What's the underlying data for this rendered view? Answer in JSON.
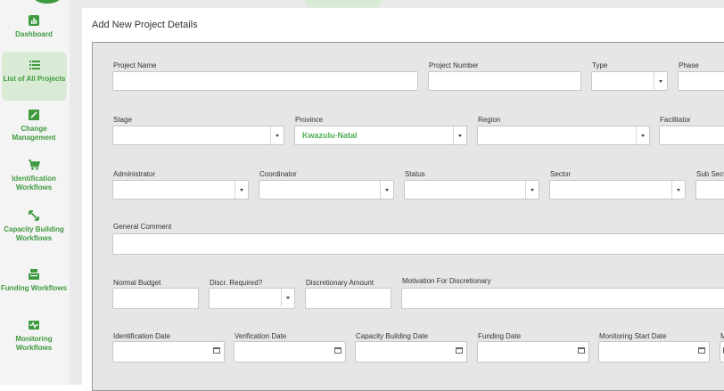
{
  "sidebar": {
    "items": [
      {
        "label": "Dashboard",
        "icon": "bar-chart-icon"
      },
      {
        "label": "List of All Projects",
        "icon": "list-icon",
        "active": true
      },
      {
        "label": "Change Management",
        "icon": "edit-icon"
      },
      {
        "label": "Identification Workflows",
        "icon": "cart-icon"
      },
      {
        "label": "Capacity Building Workflows",
        "icon": "arrows-icon"
      },
      {
        "label": "Funding Workflows",
        "icon": "register-icon"
      },
      {
        "label": "Monitoring Workflows",
        "icon": "pulse-icon"
      }
    ]
  },
  "modal": {
    "title": "Add New Project Details",
    "fields": {
      "project_name": {
        "label": "Project Name",
        "value": ""
      },
      "project_number": {
        "label": "Project Number",
        "value": ""
      },
      "type": {
        "label": "Type",
        "value": ""
      },
      "phase": {
        "label": "Phase",
        "value": ""
      },
      "stage": {
        "label": "Stage",
        "value": ""
      },
      "province": {
        "label": "Province",
        "value": "Kwazulu-Natal"
      },
      "region": {
        "label": "Region",
        "value": ""
      },
      "facilitator": {
        "label": "Facilitator",
        "value": ""
      },
      "administrator": {
        "label": "Administrator",
        "value": ""
      },
      "coordinator": {
        "label": "Coordinator",
        "value": ""
      },
      "status": {
        "label": "Status",
        "value": ""
      },
      "sector": {
        "label": "Sector",
        "value": ""
      },
      "sub_sector": {
        "label": "Sub Sect",
        "value": ""
      },
      "general_comment": {
        "label": "General Comment",
        "value": ""
      },
      "normal_budget": {
        "label": "Normal Budget",
        "value": ""
      },
      "discr_required": {
        "label": "Discr. Required?",
        "value": ""
      },
      "discretionary_amount": {
        "label": "Discretionary Amount",
        "value": ""
      },
      "motivation": {
        "label": "Motivation For Discretionary",
        "value": ""
      },
      "identification_date": {
        "label": "Identification Date",
        "value": ""
      },
      "verification_date": {
        "label": "Verification Date",
        "value": ""
      },
      "capacity_building_date": {
        "label": "Capacity Building Date",
        "value": ""
      },
      "funding_date": {
        "label": "Funding Date",
        "value": ""
      },
      "monitoring_start_date": {
        "label": "Monitoring Start Date",
        "value": ""
      },
      "cut_label": {
        "label": "M",
        "value": ""
      }
    }
  },
  "colors": {
    "accent": "#3e9a3e",
    "selected_value": "#4caf50",
    "nav_active_bg": "#d9ebd4"
  }
}
